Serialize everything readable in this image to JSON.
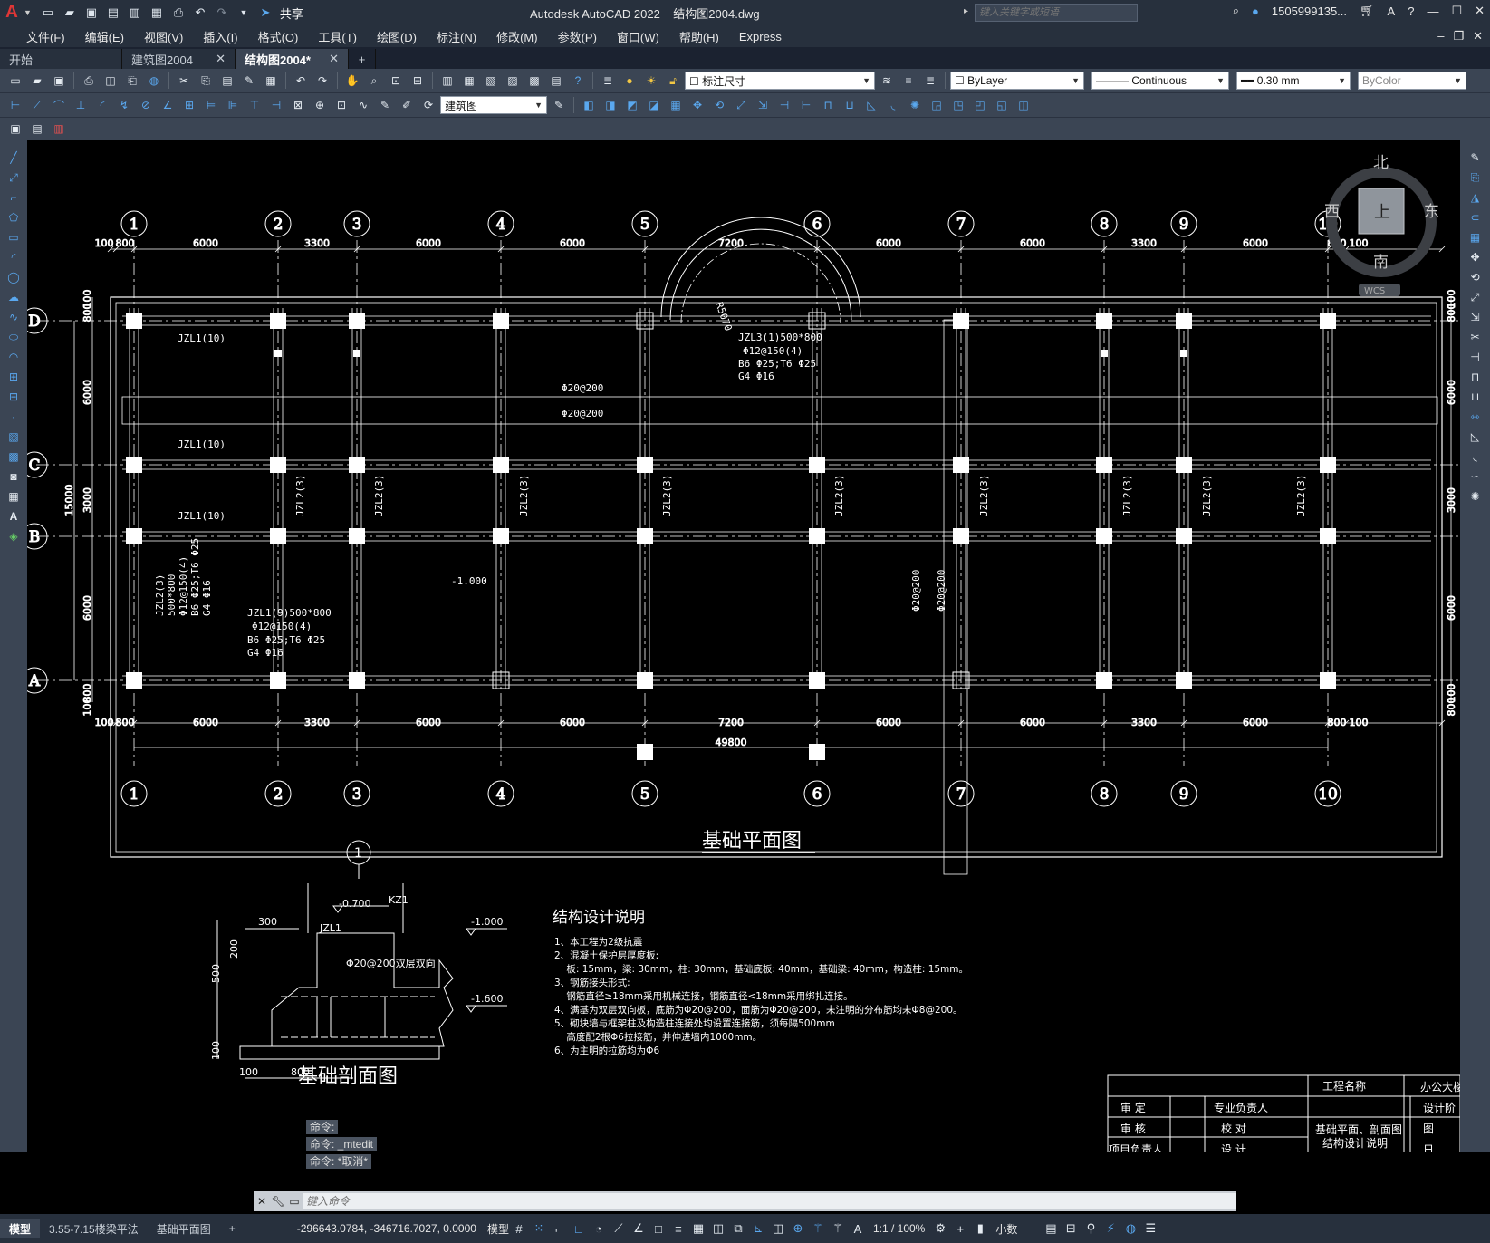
{
  "app": {
    "logo": "A",
    "title": "Autodesk AutoCAD 2022",
    "file": "结构图2004.dwg",
    "search_placeholder": "键入关键字或短语",
    "user": "1505999135...",
    "share": "共享"
  },
  "menu": [
    "文件(F)",
    "编辑(E)",
    "视图(V)",
    "插入(I)",
    "格式(O)",
    "工具(T)",
    "绘图(D)",
    "标注(N)",
    "修改(M)",
    "参数(P)",
    "窗口(W)",
    "帮助(H)",
    "Express"
  ],
  "tabs": [
    {
      "label": "开始",
      "close": false
    },
    {
      "label": "建筑图2004",
      "close": true
    },
    {
      "label": "结构图2004*",
      "close": true,
      "active": true
    }
  ],
  "toolbar": {
    "layer": "标注尺寸",
    "color": "ByLayer",
    "linetype": "Continuous",
    "lineweight": "0.30 mm",
    "plotstyle": "ByColor",
    "layer2": "建筑图"
  },
  "viewcube": {
    "north": "北",
    "south": "南",
    "east": "东",
    "west": "西",
    "top": "上",
    "wcs": "WCS"
  },
  "drawing": {
    "axes_h": [
      "1",
      "2",
      "3",
      "4",
      "5",
      "6",
      "7",
      "8",
      "9",
      "10"
    ],
    "axes_v": [
      "D",
      "C",
      "B",
      "A"
    ],
    "top_dims": [
      "100",
      "800",
      "6000",
      "3300",
      "6000",
      "6000",
      "7200",
      "6000",
      "6000",
      "3300",
      "6000",
      "800",
      "100"
    ],
    "bottom_dims": [
      "100",
      "800",
      "6000",
      "3300",
      "6000",
      "6000",
      "7200",
      "6000",
      "6000",
      "3300",
      "6000",
      "800",
      "100"
    ],
    "total_width": "49800",
    "left_dims": [
      "100",
      "800",
      "6000",
      "3000",
      "6000",
      "100",
      "800"
    ],
    "right_dims": [
      "100",
      "800",
      "6000",
      "3000",
      "6000",
      "800",
      "100"
    ],
    "total_height": "15000",
    "labels": {
      "jzl1_d": "JZL1(10)",
      "jzl1_c": "JZL1(10)",
      "jzl1_b": "JZL1(10)",
      "jzl3_1": "JZL3(1)500*800",
      "jzl3_2": "Φ12@150(4)",
      "jzl3_3": "B6 Φ25;T6 Φ25",
      "jzl3_4": "G4 Φ16",
      "r": "R5070",
      "rebar1": "Φ20@200",
      "rebar2": "Φ20@200",
      "jzl2": "JZL2(3)",
      "jzl2_a": "JZL2(3)",
      "jzl2_b": "500*800",
      "jzl2_c": "Φ12@150(4)",
      "jzl2_d": "B6 Φ25;T6 Φ25",
      "jzl2_e": "G4 Φ16",
      "jzl1_9a": "JZL1(9)500*800",
      "jzl1_9b": "Φ12@150(4)",
      "jzl1_9c": "B6 Φ25;T6 Φ25",
      "jzl1_9d": "G4 Φ16",
      "elev": "-1.000",
      "vert1": "Φ20@200",
      "vert2": "Φ20@200"
    },
    "plan_title": "基础平面图",
    "section": {
      "axis": "1",
      "kz": "KZ1",
      "el1": "-0.700",
      "jzl": "JZL1",
      "d300": "300",
      "d200": "200",
      "d500": "500",
      "d100": "100",
      "d100b": "100",
      "d800": "800",
      "el2": "-1.000",
      "el3": "-1.600",
      "note": "Φ20@200双层双向",
      "title": "基础剖面图"
    },
    "notes": {
      "title": "结构设计说明",
      "lines": [
        "1、本工程为2级抗震",
        "2、混凝土保护层厚度板:",
        "    板: 15mm，梁: 30mm，柱: 30mm，基础底板: 40mm，基础梁: 40mm，构造柱: 15mm。",
        "3、钢筋接头形式:",
        "    钢筋直径≥18mm采用机械连接，钢筋直径<18mm采用绑扎连接。",
        "4、满基为双层双向板，底筋为Φ20@200，面筋为Φ20@200，未注明的分布筋均未Φ8@200。",
        "5、砌块墙与框架柱及构造柱连接处均设置连接筋，须每隔500mm",
        "    高度配2根Φ6拉接筋，并伸进墙内1000mm。",
        "6、为主明的拉筋均为Φ6"
      ]
    },
    "titleblock": {
      "project_label": "工程名称",
      "project_value": "办公大楼",
      "r1a": "审  定",
      "r1b": "专业负责人",
      "r1c": "设计阶",
      "r2a": "审  核",
      "r2b": "校  对",
      "r2c": "图",
      "r3a": "项目负责人",
      "r3b": "设  计",
      "r3c": "日",
      "drawing_name1": "基础平面、剖面图",
      "drawing_name2": "结构设计说明"
    }
  },
  "command_history": [
    "命令:",
    "命令: _mtedit",
    "命令: *取消*"
  ],
  "command_placeholder": "键入命令",
  "status": {
    "tabs": [
      "模型",
      "3.55-7.15楼梁平法",
      "基础平面图"
    ],
    "coords": "-296643.0784, -346716.7027, 0.0000",
    "mode": "模型",
    "scale": "1:1 / 100%",
    "units": "小数"
  }
}
